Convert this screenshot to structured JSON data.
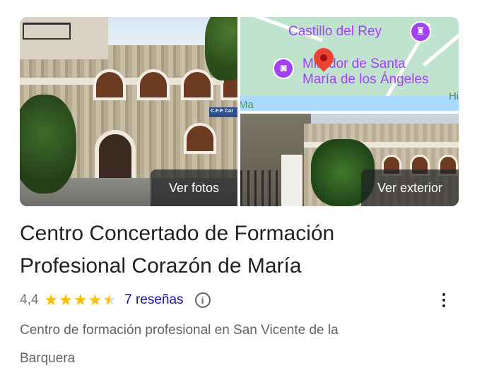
{
  "gallery": {
    "photos_button": "Ver fotos",
    "exterior_button": "Ver exterior",
    "sign_text": "C.F.P. Cor",
    "map": {
      "poi1": "Castillo del Rey",
      "poi2_line1": "Mirador de Santa",
      "poi2_line2": "María de los Ángeles",
      "frag_left": "Ma",
      "frag_right": "Hi"
    }
  },
  "place": {
    "title_line1": "Centro Concertado de Formación",
    "title_line2": "Profesional Corazón de María",
    "rating": "4,4",
    "rating_value": 4.4,
    "reviews": "7 reseñas",
    "category_line1": "Centro de formación profesional en San Vicente de la",
    "category_line2": "Barquera"
  },
  "colors": {
    "star": "#fbbc04",
    "link": "#1a0dab",
    "poi": "#a142f4",
    "pin": "#ea4335"
  }
}
